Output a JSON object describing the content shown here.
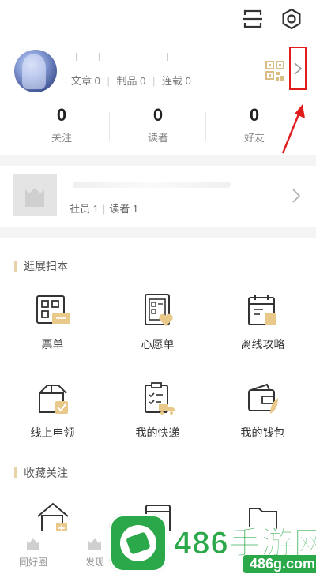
{
  "profile": {
    "stats": [
      {
        "label": "文章",
        "value": "0"
      },
      {
        "label": "制品",
        "value": "0"
      },
      {
        "label": "连载",
        "value": "0"
      }
    ],
    "counts": [
      {
        "value": "0",
        "label": "关注"
      },
      {
        "value": "0",
        "label": "读者"
      },
      {
        "value": "0",
        "label": "好友"
      }
    ]
  },
  "club": {
    "members_label": "社员 1",
    "readers_label": "读者 1"
  },
  "sections": [
    {
      "title": "逛展扫本",
      "items": [
        {
          "label": "票单",
          "icon": "ticket-icon"
        },
        {
          "label": "心愿单",
          "icon": "wishlist-icon"
        },
        {
          "label": "离线攻略",
          "icon": "offline-guide-icon"
        },
        {
          "label": "线上申领",
          "icon": "online-claim-icon"
        },
        {
          "label": "我的快递",
          "icon": "delivery-icon"
        },
        {
          "label": "我的钱包",
          "icon": "wallet-icon"
        }
      ]
    },
    {
      "title": "收藏关注",
      "items": [
        {
          "label": "",
          "icon": "home-icon"
        },
        {
          "label": "",
          "icon": "box-icon"
        },
        {
          "label": "",
          "icon": "folder-icon"
        }
      ]
    }
  ],
  "bottom_nav": [
    {
      "label": "同好圈",
      "icon": "circle-icon"
    },
    {
      "label": "发现",
      "icon": "discover-icon"
    }
  ],
  "watermark": {
    "title": "486手游网",
    "url": "486g.com"
  },
  "colors": {
    "accent_gold": "#e8c98a",
    "annotation_red": "#e21b1b",
    "watermark_green": "#2ba84a"
  }
}
